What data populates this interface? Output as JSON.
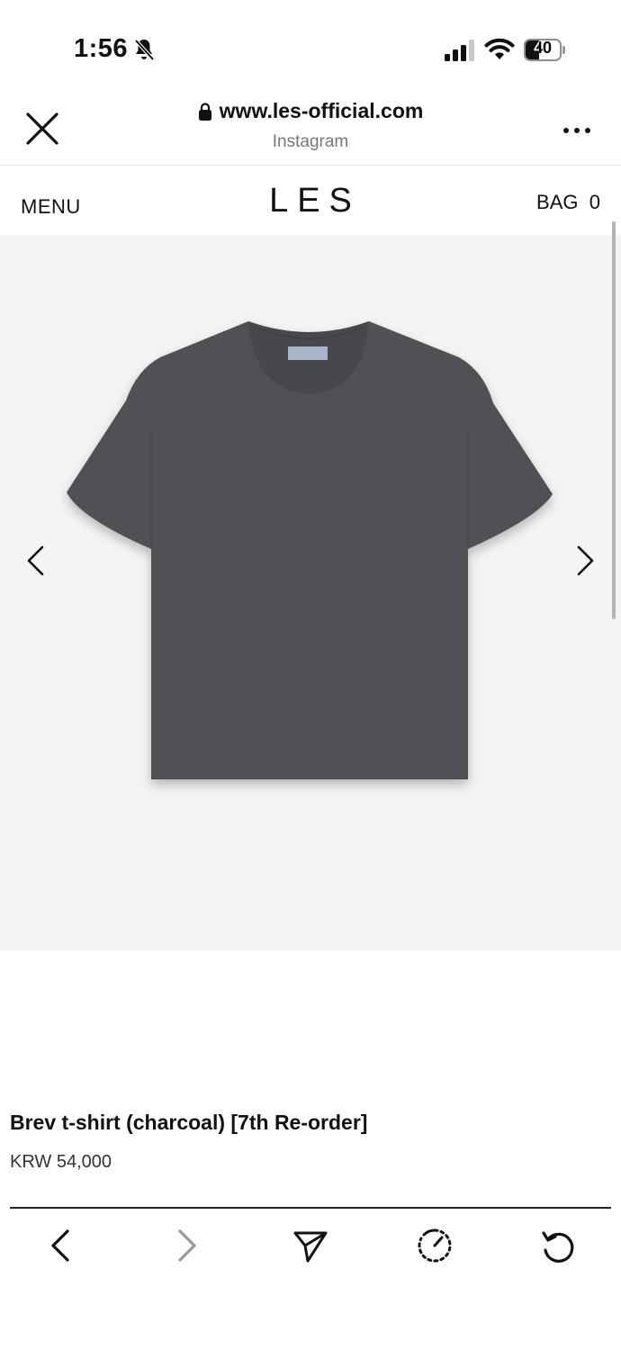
{
  "status_bar": {
    "time": "1:56",
    "battery_level": "40",
    "battery_fraction": 0.4
  },
  "browser": {
    "url": "www.les-official.com",
    "source": "Instagram"
  },
  "site": {
    "menu_label": "MENU",
    "logo": "LES",
    "bag_label": "BAG",
    "bag_count": "0"
  },
  "product": {
    "name": "Brev t-shirt (charcoal) [7th Re-order]",
    "price": "KRW 54,000"
  },
  "icons": {
    "close": "close-icon",
    "lock": "lock-icon",
    "more": "more-icon",
    "prev": "chevron-left-icon",
    "next": "chevron-right-icon",
    "back": "back-icon",
    "forward": "forward-icon",
    "share": "share-icon",
    "timer": "timer-icon",
    "reload": "reload-icon"
  },
  "colors": {
    "shirt": "#4f5154",
    "gallery_bg": "#f4f4f4",
    "label": "#a9b4c8"
  }
}
